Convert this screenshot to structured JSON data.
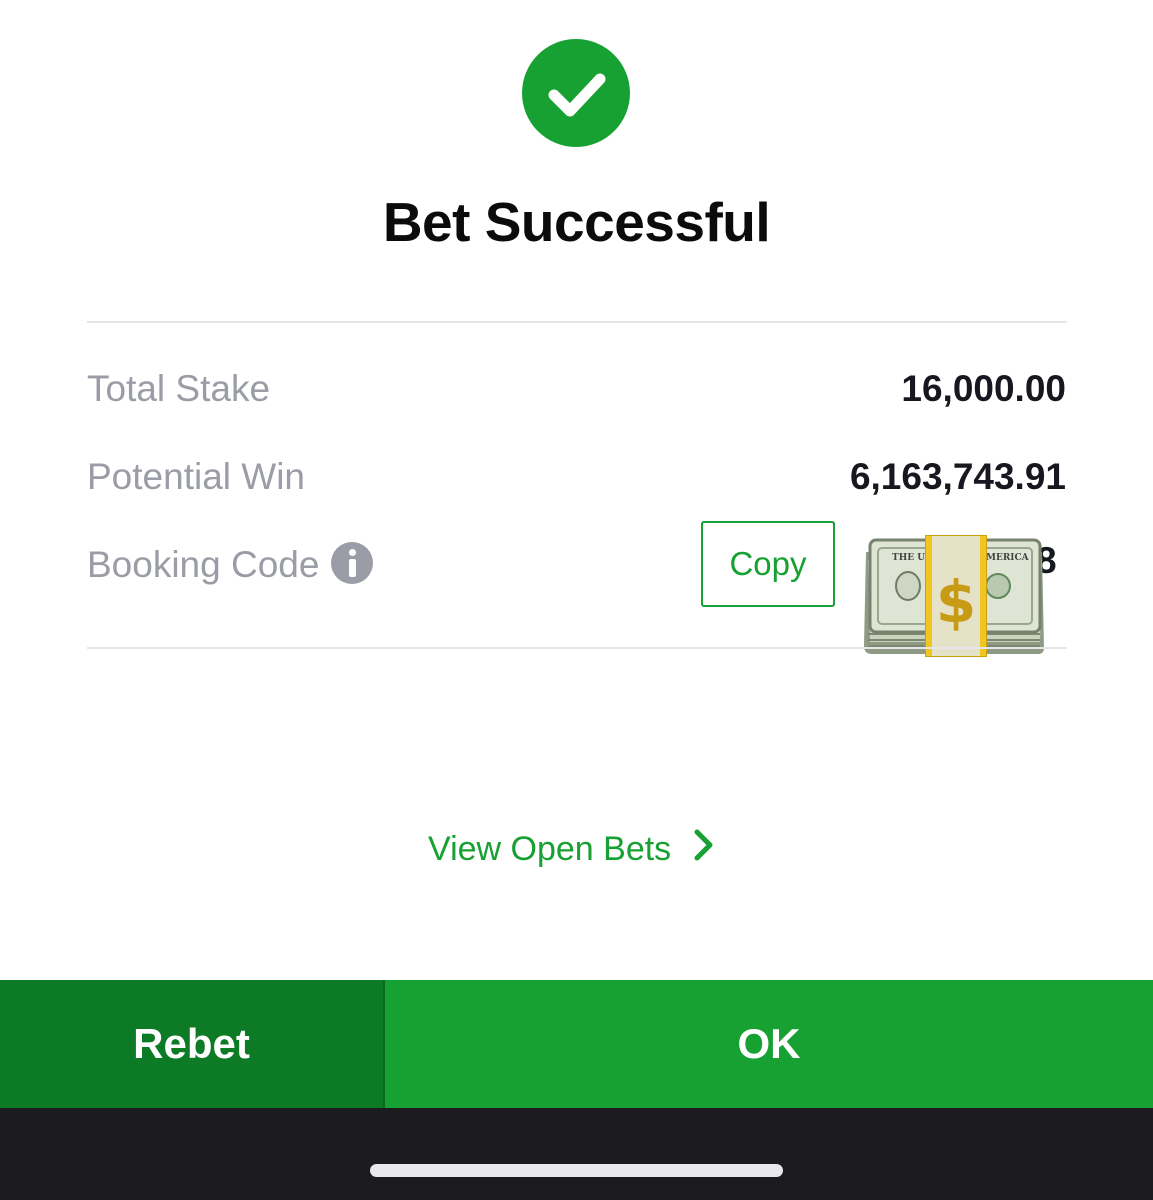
{
  "header": {
    "status_icon": "check-circle-icon",
    "title": "Bet Successful"
  },
  "summary": {
    "total_stake_label": "Total Stake",
    "total_stake_value": "16,000.00",
    "potential_win_label": "Potential Win",
    "potential_win_value": "6,163,743.91",
    "booking_code_label": "Booking Code",
    "booking_code_info_icon": "info-icon",
    "booking_code_visible_tail": "8",
    "copy_label": "Copy",
    "overlay_emoji": "money-stack-emoji"
  },
  "links": {
    "view_open_bets": "View Open Bets"
  },
  "footer": {
    "rebet_label": "Rebet",
    "ok_label": "OK"
  },
  "colors": {
    "accent_green": "#17a132",
    "dark_green": "#0d7a25",
    "label_gray": "#9a9ca6",
    "value_text": "#17171f",
    "system_bar": "#1c1c20"
  }
}
